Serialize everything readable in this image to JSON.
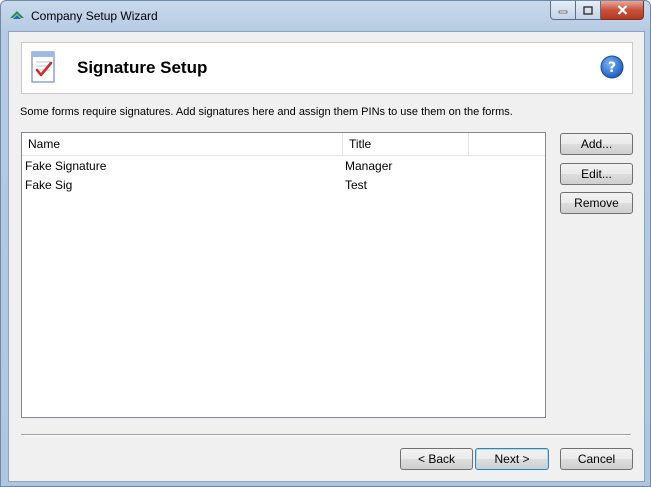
{
  "window": {
    "title": "Company Setup Wizard"
  },
  "header": {
    "title": "Signature Setup",
    "icon": "document-checkmark-icon",
    "help_icon": "help-icon"
  },
  "instructions": "Some forms require signatures. Add signatures here and assign them PINs to use them on the forms.",
  "list": {
    "columns": [
      "Name",
      "Title"
    ],
    "rows": [
      {
        "name": "Fake Signature",
        "title": "Manager"
      },
      {
        "name": "Fake Sig",
        "title": "Test"
      }
    ]
  },
  "side_buttons": {
    "add": "Add...",
    "edit": "Edit...",
    "remove": "Remove"
  },
  "nav_buttons": {
    "back": "< Back",
    "next": "Next >",
    "cancel": "Cancel"
  },
  "colors": {
    "help_blue": "#1f5fbf",
    "check_red": "#d42a2a",
    "close_red": "#c8523c"
  }
}
